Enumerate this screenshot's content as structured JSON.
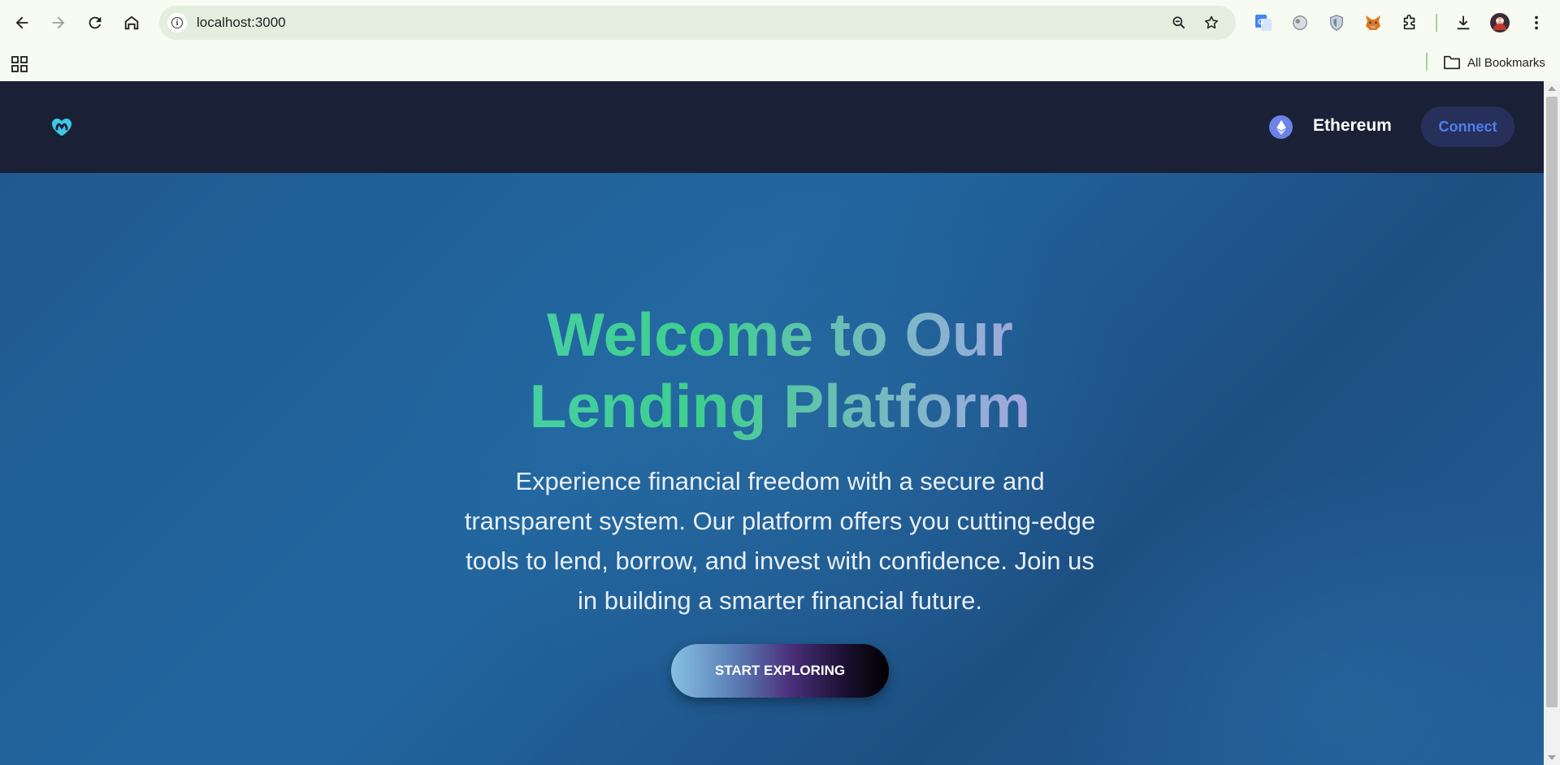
{
  "browser": {
    "url": "localhost:3000",
    "bookmarks_label": "All Bookmarks"
  },
  "navbar": {
    "network_label": "Ethereum",
    "connect_label": "Connect"
  },
  "hero": {
    "title_line1": "Welcome to Our",
    "title_line2": "Lending Platform",
    "description": "Experience financial freedom with a secure and transparent system. Our platform offers you cutting-edge tools to lend, borrow, and invest with confidence. Join us in building a smarter financial future.",
    "cta_label": "START EXPLORING"
  },
  "colors": {
    "navbar_bg": "#1a2035",
    "hero_bg": "#2266a0",
    "connect_text": "#4f7ef0",
    "connect_bg": "#27305a",
    "eth_icon": "#6c82e6",
    "logo": "#3cc8e6"
  },
  "icons": [
    "back-icon",
    "forward-icon",
    "reload-icon",
    "home-icon",
    "site-info-icon",
    "zoom-icon",
    "bookmark-star-icon",
    "google-translate-icon",
    "extension-icon",
    "shield-icon",
    "metamask-icon",
    "puzzle-icon",
    "download-icon",
    "profile-avatar",
    "menu-icon",
    "apps-icon",
    "folder-icon",
    "logo-icon",
    "ethereum-icon"
  ]
}
